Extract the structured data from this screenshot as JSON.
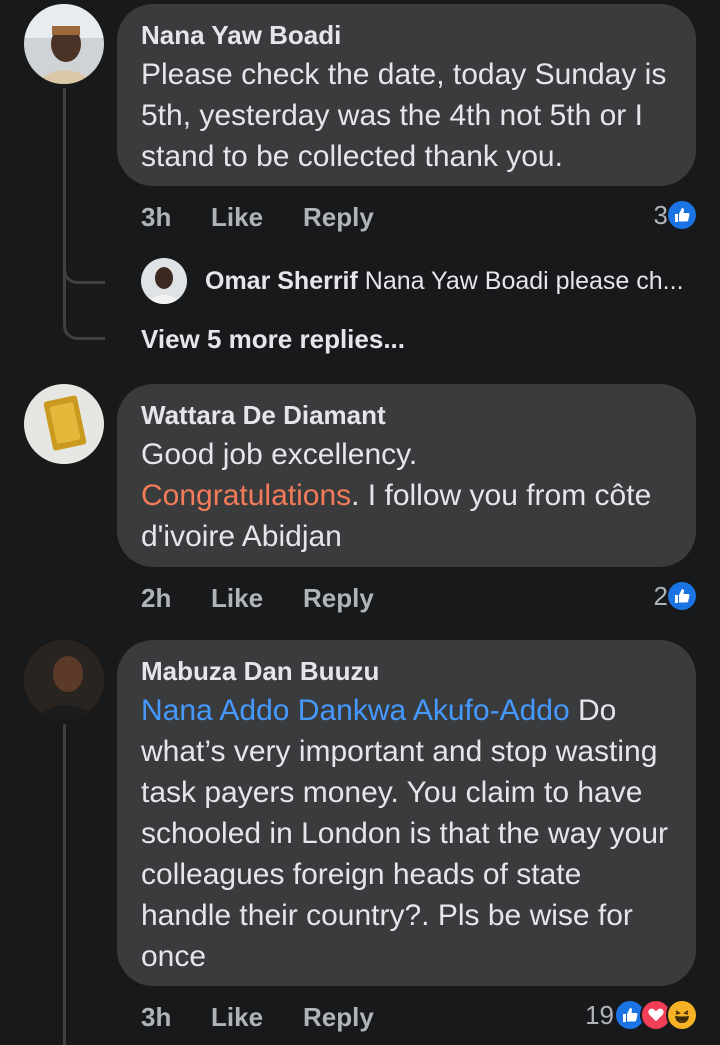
{
  "comments": [
    {
      "author": "Nana Yaw Boadi",
      "body": "Please check the date, today Sunday is 5th, yesterday was the 4th not 5th or I stand to be collected thank you.",
      "time": "3h",
      "like_label": "Like",
      "reply_label": "Reply",
      "reaction_count": "3",
      "reactions": [
        "like-icon"
      ],
      "replies": {
        "preview_author": "Omar Sherrif",
        "preview_text": "Nana Yaw Boadi please ch...",
        "view_more": "View 5 more replies..."
      }
    },
    {
      "author": "Wattara De Diamant",
      "body_line1": "Good job excellency.",
      "body_highlight": "Congratulations",
      "body_rest": ". I follow you from côte d'ivoire Abidjan",
      "time": "2h",
      "like_label": "Like",
      "reply_label": "Reply",
      "reaction_count": "2",
      "reactions": [
        "like-icon"
      ]
    },
    {
      "author": "Mabuza Dan Buuzu",
      "mention": "Nana Addo Dankwa Akufo-Addo",
      "body": " Do what’s very important and stop wasting task payers money. You claim to have schooled in London is that the way your colleagues foreign heads of state handle their country?. Pls be wise for once",
      "time": "3h",
      "like_label": "Like",
      "reply_label": "Reply",
      "reaction_count": "19",
      "reactions": [
        "like-icon",
        "love-icon",
        "haha-icon"
      ]
    }
  ],
  "colors": {
    "background": "#18191a",
    "bubble": "#3a3b3c",
    "mention": "#4599ff",
    "highlight": "#f37b5a",
    "like": "#1b74e4",
    "love": "#f33e58",
    "haha": "#f7b125"
  }
}
